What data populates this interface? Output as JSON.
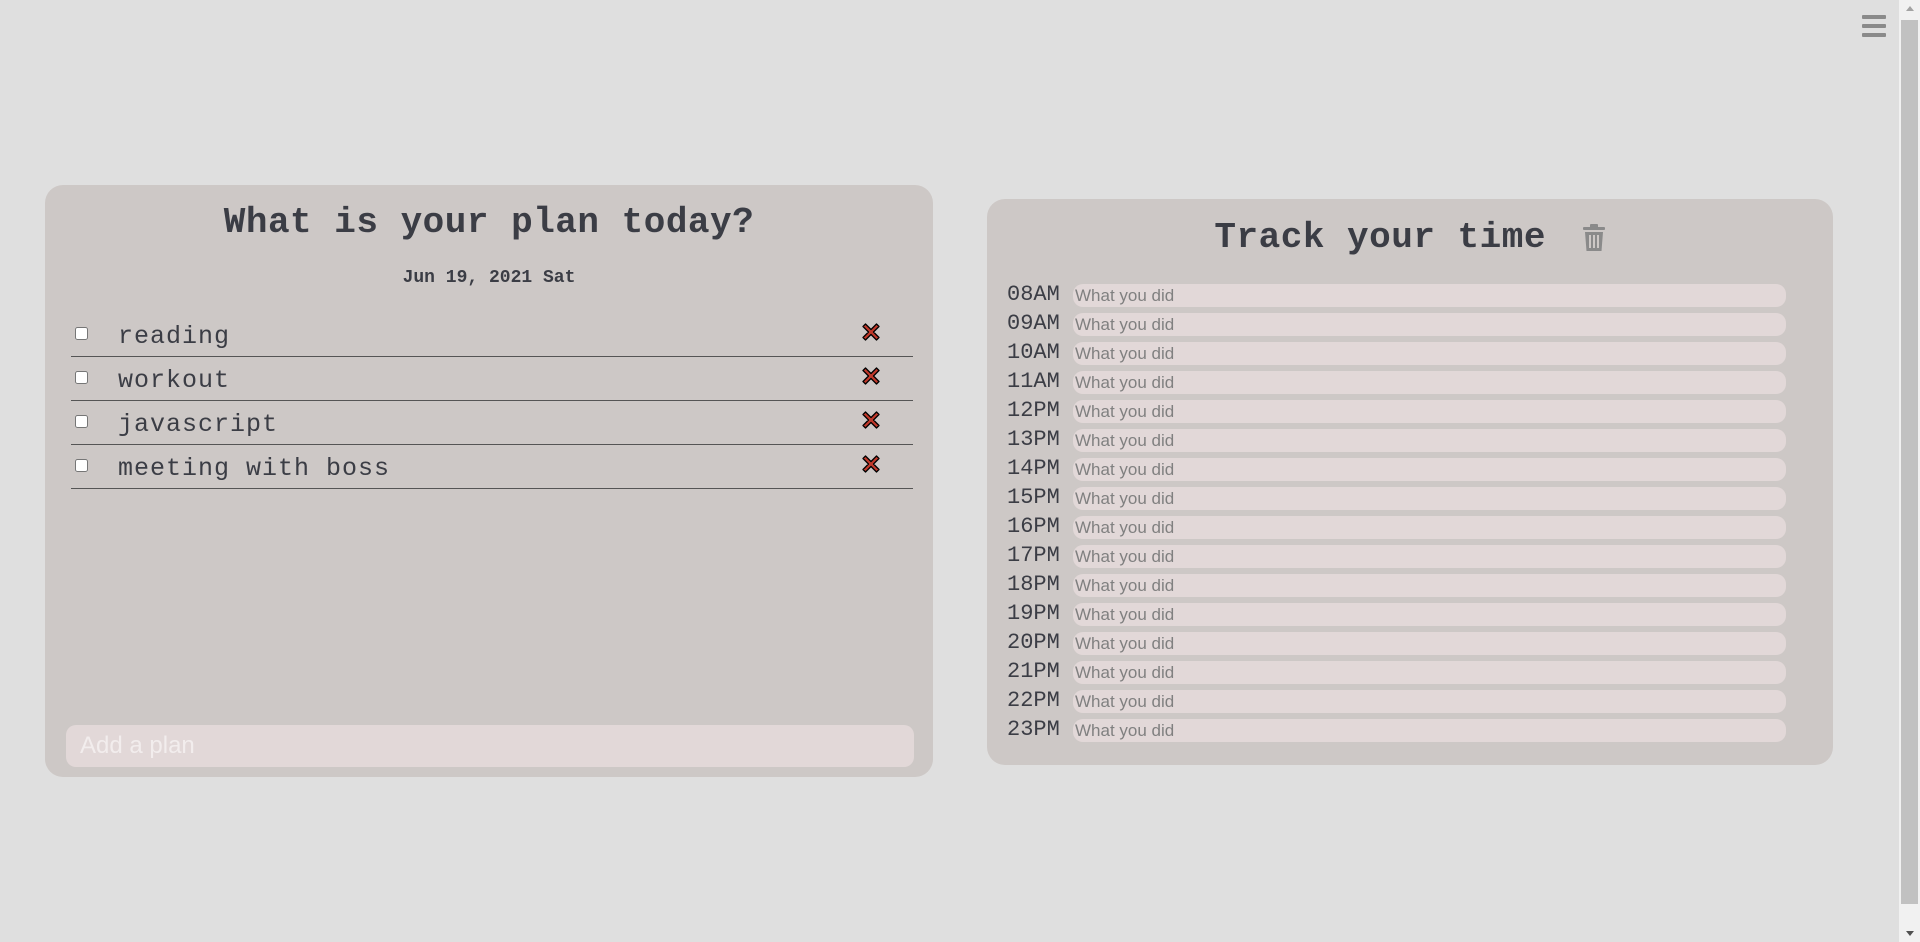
{
  "menu": {
    "icon": "hamburger-menu-icon"
  },
  "plan": {
    "title": "What is your plan today?",
    "date": "Jun 19, 2021 Sat",
    "items": [
      {
        "label": "reading",
        "checked": false
      },
      {
        "label": "workout",
        "checked": false
      },
      {
        "label": "javascript",
        "checked": false
      },
      {
        "label": "meeting with boss",
        "checked": false
      }
    ],
    "delete_icon": "red-x-icon",
    "add_placeholder": "Add a plan",
    "add_value": ""
  },
  "track": {
    "title": "Track your time",
    "trash_icon": "trash-icon",
    "placeholder": "What you did",
    "hours": [
      "08AM",
      "09AM",
      "10AM",
      "11AM",
      "12PM",
      "13PM",
      "14PM",
      "15PM",
      "16PM",
      "17PM",
      "18PM",
      "19PM",
      "20PM",
      "21PM",
      "22PM",
      "23PM"
    ]
  },
  "colors": {
    "background": "#dfdfdf",
    "card": "#cdc8c6",
    "input": "#e2d8d8",
    "text": "#3b3d45",
    "delete": "#c0392b",
    "trash": "#8a8a8a"
  }
}
